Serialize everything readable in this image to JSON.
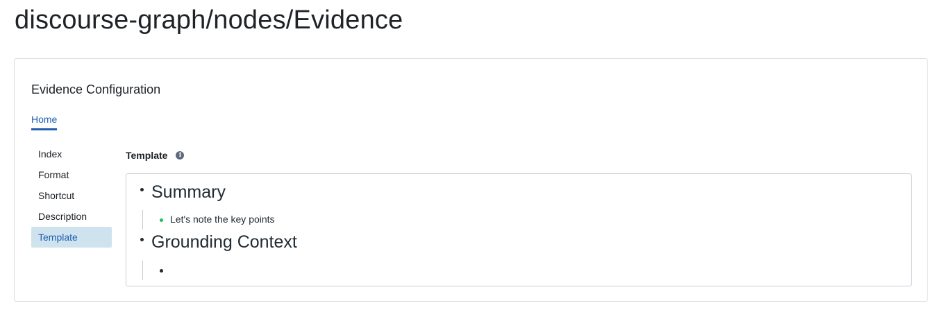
{
  "page": {
    "title": "discourse-graph/nodes/Evidence"
  },
  "config": {
    "title": "Evidence Configuration",
    "home_tab": "Home",
    "nav_items": [
      {
        "label": "Index",
        "active": false
      },
      {
        "label": "Format",
        "active": false
      },
      {
        "label": "Shortcut",
        "active": false
      },
      {
        "label": "Description",
        "active": false
      },
      {
        "label": "Template",
        "active": true
      }
    ],
    "template_label": "Template",
    "info_icon": "info-icon",
    "blocks": [
      {
        "heading": "Summary",
        "child": "Let's note the key points",
        "child_bullet_color": "#1ec05a"
      },
      {
        "heading": "Grounding Context",
        "child": "",
        "child_bullet_color": "#202b33"
      }
    ]
  },
  "colors": {
    "accent": "#215db0",
    "active_bg": "#cfe3ef"
  }
}
